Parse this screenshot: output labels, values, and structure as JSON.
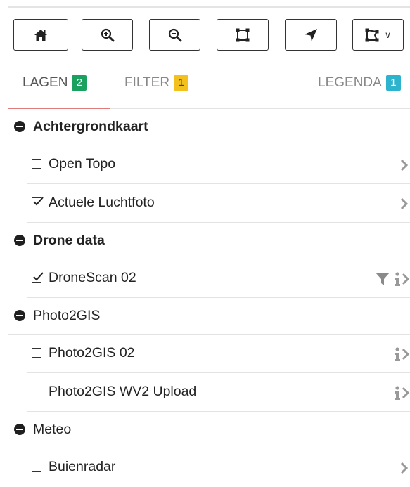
{
  "toolbar": {
    "buttons": [
      {
        "name": "home-button",
        "icon": "home-icon"
      },
      {
        "name": "zoom-in-button",
        "icon": "zoom-in-icon"
      },
      {
        "name": "zoom-out-button",
        "icon": "zoom-out-icon"
      },
      {
        "name": "full-extent-button",
        "icon": "extent-icon"
      },
      {
        "name": "locate-button",
        "icon": "location-arrow-icon"
      },
      {
        "name": "draw-dropdown-button",
        "icon": "draw-shape-icon"
      }
    ]
  },
  "tabs": [
    {
      "label": "LAGEN",
      "count": "2",
      "color": "#1aa160",
      "active": true
    },
    {
      "label": "FILTER",
      "count": "1",
      "color": "#f3c11e",
      "active": false
    },
    {
      "label": "LEGENDA",
      "count": "1",
      "color": "#2eb3cf",
      "active": false
    }
  ],
  "groups": [
    {
      "label": "Achtergrondkaart",
      "bold": true,
      "layers": [
        {
          "label": "Open Topo",
          "checked": false,
          "actions": [
            "chevron-right-icon"
          ]
        },
        {
          "label": "Actuele Luchtfoto",
          "checked": true,
          "actions": [
            "chevron-right-icon"
          ]
        }
      ]
    },
    {
      "label": "Drone data",
      "bold": true,
      "layers": [
        {
          "label": "DroneScan 02",
          "checked": true,
          "actions": [
            "filter-icon",
            "info-icon",
            "chevron-right-icon"
          ]
        }
      ]
    },
    {
      "label": "Photo2GIS",
      "bold": false,
      "layers": [
        {
          "label": "Photo2GIS 02",
          "checked": false,
          "actions": [
            "info-icon",
            "chevron-right-icon"
          ]
        },
        {
          "label": "Photo2GIS WV2 Upload",
          "checked": false,
          "actions": [
            "info-icon",
            "chevron-right-icon"
          ]
        }
      ]
    },
    {
      "label": "Meteo",
      "bold": false,
      "layers": [
        {
          "label": "Buienradar",
          "checked": false,
          "actions": [
            "chevron-right-icon"
          ]
        }
      ]
    }
  ]
}
